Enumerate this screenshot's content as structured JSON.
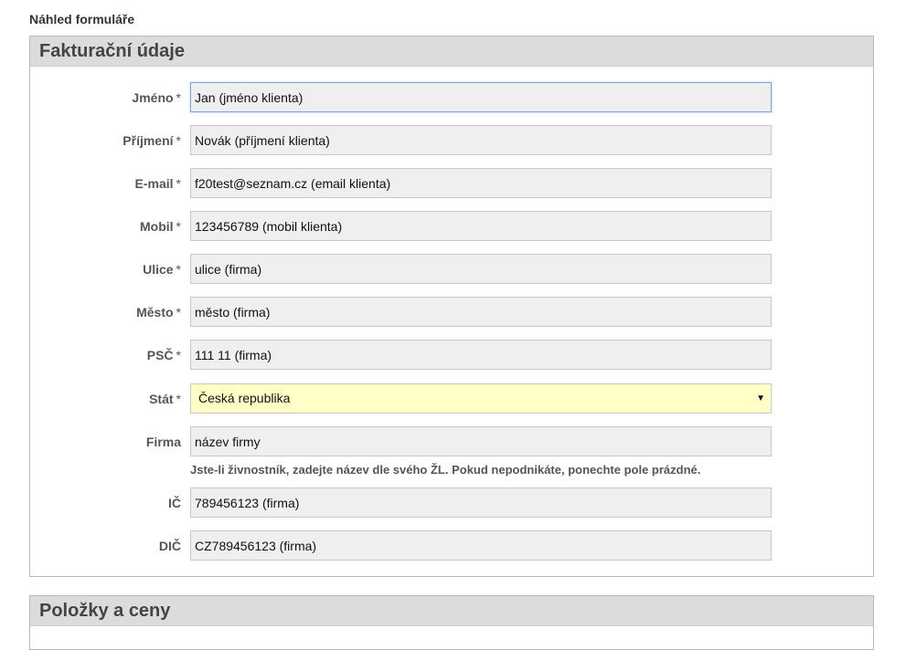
{
  "page": {
    "heading": "Náhled formuláře"
  },
  "billing": {
    "title": "Fakturační údaje",
    "required_mark": "*",
    "fields": [
      {
        "label": "Jméno",
        "value": "Jan (jméno klienta)",
        "required": true
      },
      {
        "label": "Příjmení",
        "value": "Novák (příjmení klienta)",
        "required": true
      },
      {
        "label": "E-mail",
        "value": "f20test@seznam.cz (email klienta)",
        "required": true
      },
      {
        "label": "Mobil",
        "value": "123456789 (mobil klienta)",
        "required": true
      },
      {
        "label": "Ulice",
        "value": "ulice (firma)",
        "required": true
      },
      {
        "label": "Město",
        "value": "město (firma)",
        "required": true
      },
      {
        "label": "PSČ",
        "value": "111 11 (firma)",
        "required": true
      }
    ],
    "country": {
      "label": "Stát",
      "selected": "Česká republika",
      "caret": "▼"
    },
    "company": {
      "label": "Firma",
      "value": "název firmy",
      "hint": "Jste-li živnostník, zadejte název dle svého ŽL. Pokud nepodnikáte, ponechte pole prázdné."
    },
    "ic": {
      "label": "IČ",
      "value": "789456123 (firma)"
    },
    "dic": {
      "label": "DIČ",
      "value": "CZ789456123 (firma)"
    }
  },
  "items": {
    "title": "Položky a ceny"
  }
}
